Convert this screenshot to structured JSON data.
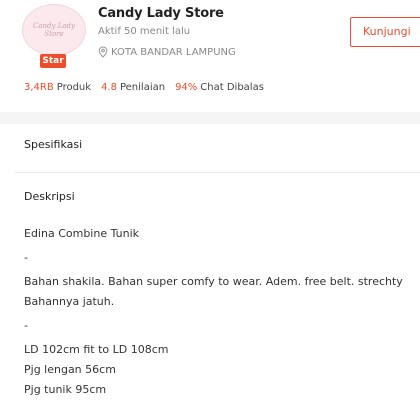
{
  "shop": {
    "name": "Candy Lady Store",
    "active": "Aktif 50 menit lalu",
    "location": "KOTA BANDAR LAMPUNG",
    "badge": "Star",
    "logo_text": "Candy Lady Store",
    "visit_label": "Kunjungi"
  },
  "stats": [
    {
      "value": "3,4RB",
      "label": "Produk"
    },
    {
      "value": "4.8",
      "label": "Penilaian"
    },
    {
      "value": "94%",
      "label": "Chat Dibalas"
    }
  ],
  "sections": {
    "spec_title": "Spesifikasi",
    "desc_title": "Deskripsi"
  },
  "description": {
    "lines": [
      "Edina Combine Tunik",
      "-",
      "Bahan shakila. Bahan super comfy to wear. Adem. free belt. strechty",
      "Bahannya jatuh.",
      "-",
      "LD 102cm fit to LD 108cm",
      "Pjg lengan 56cm",
      "Pjg tunik 95cm"
    ]
  },
  "colors": {
    "accent": "#ee4d2d"
  }
}
